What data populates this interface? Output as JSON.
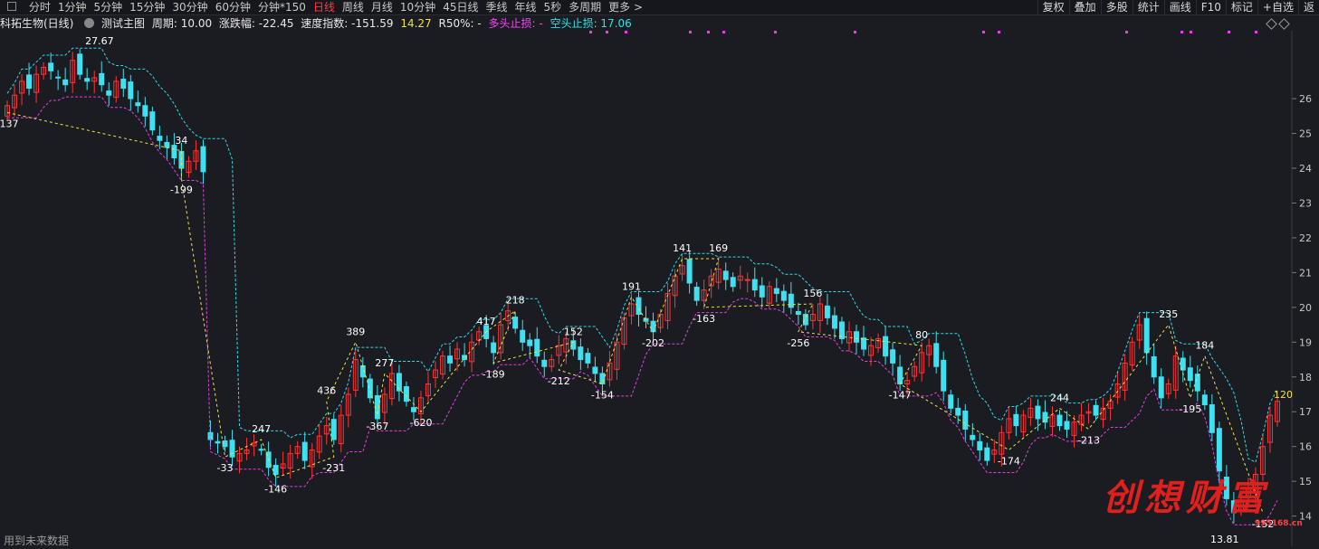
{
  "toolbar": {
    "periods": [
      "分时",
      "1分钟",
      "5分钟",
      "15分钟",
      "30分钟",
      "60分钟",
      "分钟*150",
      "日线",
      "周线",
      "月线",
      "10分钟",
      "45日线",
      "季线",
      "年线",
      "5秒",
      "多周期",
      "更多 >"
    ],
    "active": "日线",
    "right": [
      "复权",
      "叠加",
      "多股",
      "统计",
      "画线",
      "F10",
      "标记",
      "+自选",
      "返"
    ]
  },
  "info": {
    "stock": "科拓生物(日线)",
    "indicator": "测试主图",
    "period": "周期: 10.00",
    "change": "涨跌幅: -22.45",
    "speed": "速度指数: -151.59",
    "value": "14.27",
    "r50": "R50%: -",
    "long_stop": "多头止损: -",
    "short_stop": "空头止损: 17.06"
  },
  "colors": {
    "up": "#ff3434",
    "down": "#40e0f0",
    "yellow": "#f0e040",
    "magenta": "#e040e0",
    "cyan": "#30d8e8",
    "grid": "#2b2c34"
  },
  "chart_data": {
    "type": "candlestick",
    "y_ticks": [
      "26",
      "25",
      "24",
      "23",
      "22",
      "21",
      "20",
      "19",
      "18",
      "17",
      "16",
      "15",
      "14"
    ],
    "ylim": [
      13.6,
      27.9
    ],
    "max_label": "27.67",
    "min_label": "13.81",
    "last_label": "120",
    "pivots": [
      {
        "label": "-137",
        "x": 0,
        "y": 25.6,
        "pos": "below"
      },
      {
        "label": "34",
        "x": 24,
        "y": 24.5,
        "pos": "above"
      },
      {
        "label": "-199",
        "x": 24,
        "y": 23.7,
        "pos": "below"
      },
      {
        "label": "-33",
        "x": 30,
        "y": 15.7,
        "pos": "below"
      },
      {
        "label": "247",
        "x": 35,
        "y": 16.2,
        "pos": "above"
      },
      {
        "label": "-146",
        "x": 37,
        "y": 15.1,
        "pos": "below"
      },
      {
        "label": "-231",
        "x": 45,
        "y": 15.7,
        "pos": "below"
      },
      {
        "label": "436",
        "x": 44,
        "y": 17.3,
        "pos": "above"
      },
      {
        "label": "389",
        "x": 48,
        "y": 19.0,
        "pos": "above"
      },
      {
        "label": "-367",
        "x": 51,
        "y": 16.9,
        "pos": "below"
      },
      {
        "label": "277",
        "x": 52,
        "y": 18.1,
        "pos": "above"
      },
      {
        "label": "-620",
        "x": 57,
        "y": 17.0,
        "pos": "below"
      },
      {
        "label": "417",
        "x": 66,
        "y": 19.3,
        "pos": "above"
      },
      {
        "label": "218",
        "x": 70,
        "y": 19.9,
        "pos": "above"
      },
      {
        "label": "-189",
        "x": 67,
        "y": 18.4,
        "pos": "below"
      },
      {
        "label": "152",
        "x": 78,
        "y": 19.0,
        "pos": "above"
      },
      {
        "label": "-212",
        "x": 76,
        "y": 18.2,
        "pos": "below"
      },
      {
        "label": "-154",
        "x": 82,
        "y": 17.8,
        "pos": "below"
      },
      {
        "label": "191",
        "x": 86,
        "y": 20.3,
        "pos": "above"
      },
      {
        "label": "-202",
        "x": 89,
        "y": 19.3,
        "pos": "below"
      },
      {
        "label": "141",
        "x": 93,
        "y": 21.4,
        "pos": "above"
      },
      {
        "label": "169",
        "x": 98,
        "y": 21.4,
        "pos": "above"
      },
      {
        "label": "-163",
        "x": 96,
        "y": 20.0,
        "pos": "below"
      },
      {
        "label": "156",
        "x": 111,
        "y": 20.1,
        "pos": "above"
      },
      {
        "label": "-256",
        "x": 109,
        "y": 19.3,
        "pos": "below"
      },
      {
        "label": "80",
        "x": 126,
        "y": 18.9,
        "pos": "above"
      },
      {
        "label": "-147",
        "x": 123,
        "y": 17.8,
        "pos": "below"
      },
      {
        "label": "-174",
        "x": 138,
        "y": 15.9,
        "pos": "below"
      },
      {
        "label": "244",
        "x": 145,
        "y": 17.1,
        "pos": "above"
      },
      {
        "label": "-213",
        "x": 149,
        "y": 16.5,
        "pos": "below"
      },
      {
        "label": "235",
        "x": 160,
        "y": 19.5,
        "pos": "above"
      },
      {
        "label": "-195",
        "x": 163,
        "y": 17.4,
        "pos": "below"
      },
      {
        "label": "184",
        "x": 165,
        "y": 18.6,
        "pos": "above"
      },
      {
        "label": "-152",
        "x": 173,
        "y": 14.1,
        "pos": "below"
      }
    ],
    "candles_close": [
      25.8,
      26.1,
      26.5,
      26.3,
      26.7,
      26.9,
      26.8,
      26.6,
      26.4,
      27.1,
      26.7,
      26.5,
      26.6,
      26.4,
      26.1,
      26.5,
      26.3,
      26.0,
      25.8,
      25.5,
      25.1,
      24.8,
      24.6,
      24.3,
      24.0,
      24.2,
      24.5,
      23.9,
      16.2,
      16.1,
      16.0,
      15.7,
      15.8,
      15.9,
      16.1,
      15.9,
      15.4,
      15.2,
      15.5,
      15.8,
      16.0,
      15.6,
      15.9,
      16.3,
      16.6,
      16.2,
      16.9,
      17.5,
      18.5,
      18.0,
      17.4,
      16.8,
      17.5,
      18.1,
      17.6,
      17.3,
      17.0,
      17.4,
      17.8,
      18.2,
      18.6,
      18.4,
      18.8,
      18.5,
      19.0,
      19.3,
      19.1,
      18.7,
      19.5,
      19.9,
      19.4,
      19.0,
      18.9,
      18.6,
      18.3,
      18.5,
      18.9,
      19.1,
      18.8,
      18.5,
      18.4,
      18.1,
      17.8,
      18.4,
      19.0,
      19.7,
      20.1,
      19.8,
      19.6,
      19.3,
      19.8,
      20.4,
      20.9,
      21.2,
      20.7,
      20.2,
      20.5,
      20.9,
      21.1,
      20.8,
      20.6,
      20.9,
      20.8,
      20.5,
      20.3,
      20.6,
      20.4,
      20.2,
      20.0,
      19.8,
      19.5,
      19.8,
      20.1,
      19.7,
      19.4,
      19.1,
      19.3,
      19.0,
      18.8,
      18.9,
      19.1,
      18.6,
      18.4,
      17.8,
      17.9,
      18.3,
      18.7,
      18.9,
      18.3,
      17.6,
      17.1,
      16.9,
      16.5,
      16.2,
      15.9,
      15.6,
      15.9,
      16.4,
      16.8,
      16.6,
      16.9,
      17.1,
      16.8,
      16.7,
      16.9,
      16.6,
      16.5,
      16.7,
      16.9,
      17.0,
      16.9,
      17.1,
      17.3,
      17.8,
      18.4,
      19.0,
      19.5,
      18.7,
      18.0,
      17.4,
      17.8,
      18.6,
      18.2,
      17.9,
      17.6,
      17.2,
      16.4,
      15.3,
      14.5,
      14.1,
      14.4,
      14.8,
      15.2,
      16.0,
      16.9,
      17.3
    ]
  },
  "footer": "用到未来数据",
  "watermark": {
    "text": "创想财富",
    "site": "995168.cn"
  }
}
